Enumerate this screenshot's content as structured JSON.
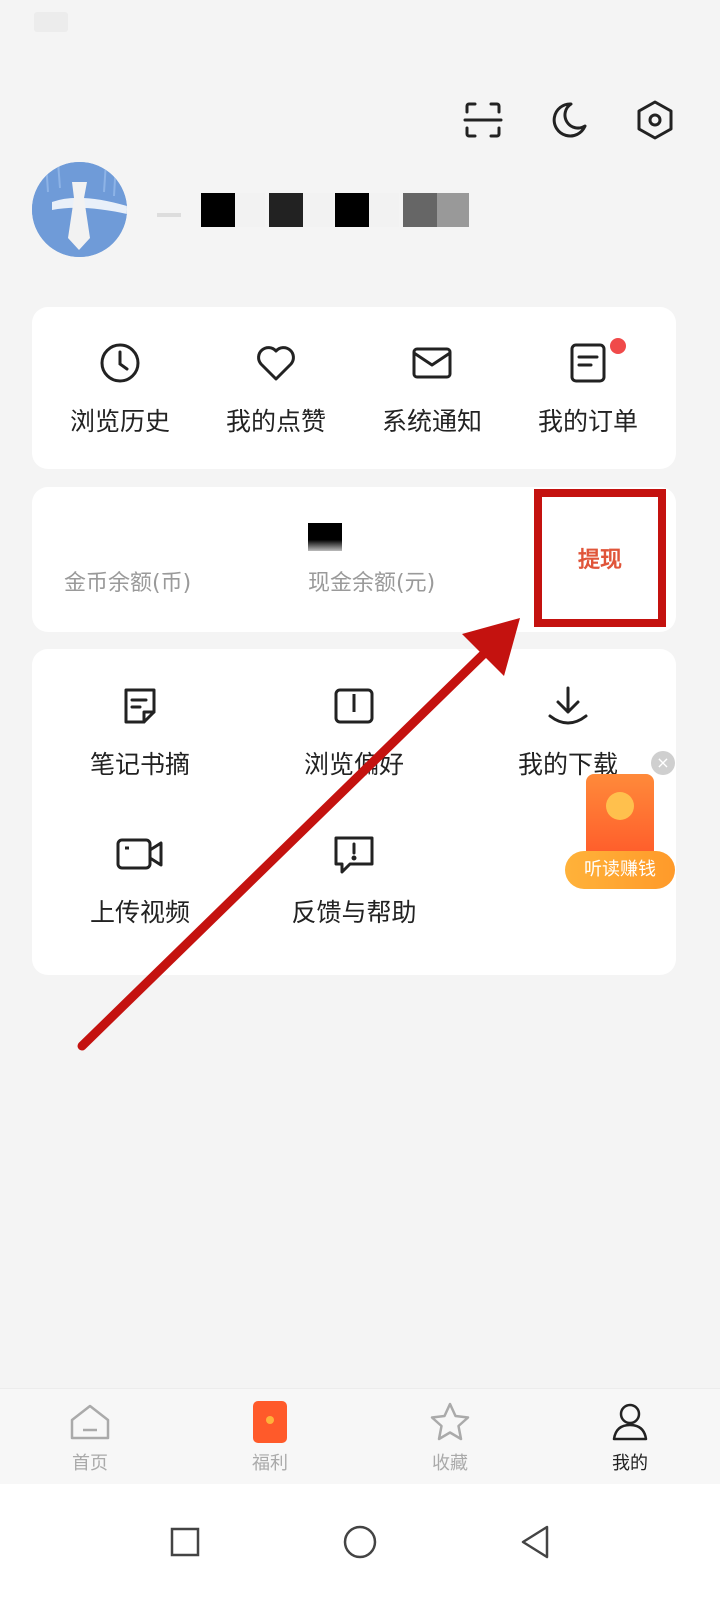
{
  "header": {
    "icons": [
      "scan-icon",
      "night-mode-icon",
      "settings-icon"
    ]
  },
  "profile": {
    "avatar": "avatar-image"
  },
  "quick_menu": {
    "items": [
      {
        "label": "浏览历史",
        "icon": "clock-icon"
      },
      {
        "label": "我的点赞",
        "icon": "heart-icon"
      },
      {
        "label": "系统通知",
        "icon": "mail-icon"
      },
      {
        "label": "我的订单",
        "icon": "order-icon",
        "badge": "red-dot"
      }
    ]
  },
  "balance": {
    "coin_label": "金币余额(币)",
    "cash_label": "现金余额(元)",
    "withdraw_label": "提现"
  },
  "tools": {
    "items": [
      {
        "label": "笔记书摘",
        "icon": "note-icon"
      },
      {
        "label": "浏览偏好",
        "icon": "book-icon"
      },
      {
        "label": "我的下载",
        "icon": "download-icon"
      },
      {
        "label": "上传视频",
        "icon": "video-camera-icon"
      },
      {
        "label": "反馈与帮助",
        "icon": "feedback-icon"
      }
    ]
  },
  "float_ad": {
    "label": "听读赚钱"
  },
  "tabbar": {
    "items": [
      {
        "label": "首页",
        "icon": "home-icon"
      },
      {
        "label": "福利",
        "icon": "red-envelope-icon"
      },
      {
        "label": "收藏",
        "icon": "star-icon"
      },
      {
        "label": "我的",
        "icon": "person-icon",
        "active": true
      }
    ]
  },
  "colors": {
    "accent": "#e0553a",
    "annotation": "#c4120f",
    "badge": "#f04a4a"
  }
}
